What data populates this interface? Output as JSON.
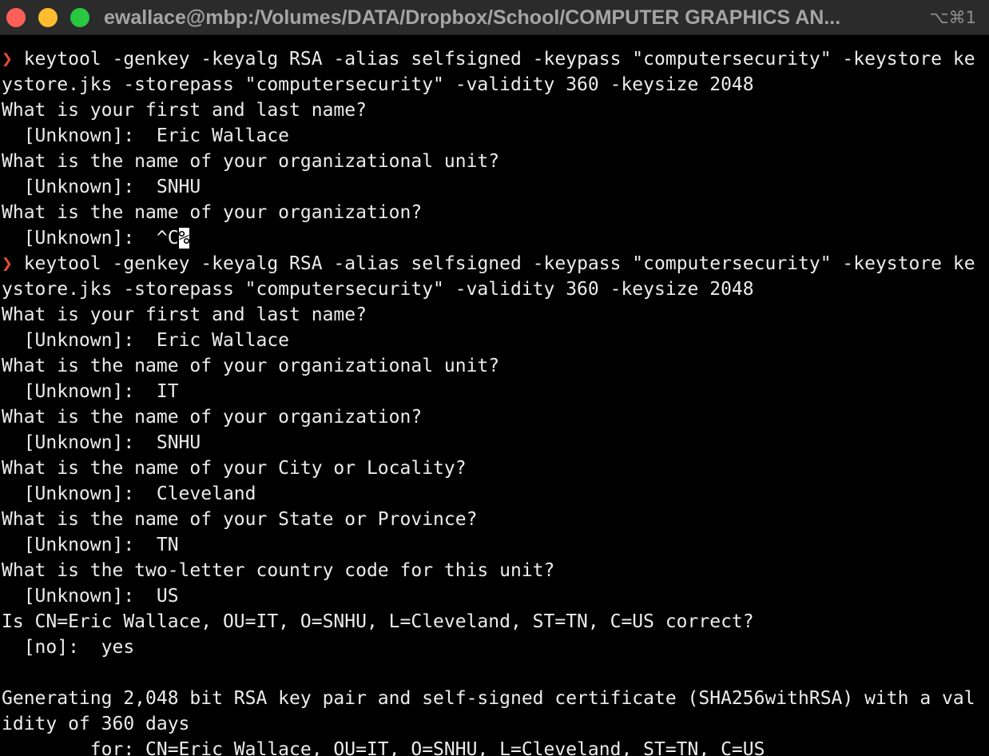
{
  "window": {
    "title": "ewallace@mbp:/Volumes/DATA/Dropbox/School/COMPUTER GRAPHICS AN...",
    "shortcut": "⌥⌘1"
  },
  "terminal": {
    "prompt_symbol": "❯",
    "cursor_char": "%",
    "lines": [
      {
        "type": "prompt",
        "text": " keytool -genkey -keyalg RSA -alias selfsigned -keypass \"computersecurity\" -keystore ke"
      },
      {
        "type": "output",
        "text": "ystore.jks -storepass \"computersecurity\" -validity 360 -keysize 2048"
      },
      {
        "type": "output",
        "text": "What is your first and last name?"
      },
      {
        "type": "output",
        "text": "  [Unknown]:  Eric Wallace"
      },
      {
        "type": "output",
        "text": "What is the name of your organizational unit?"
      },
      {
        "type": "output",
        "text": "  [Unknown]:  SNHU"
      },
      {
        "type": "output",
        "text": "What is the name of your organization?"
      },
      {
        "type": "cursor",
        "text": "  [Unknown]:  ^C"
      },
      {
        "type": "prompt",
        "text": " keytool -genkey -keyalg RSA -alias selfsigned -keypass \"computersecurity\" -keystore ke"
      },
      {
        "type": "output",
        "text": "ystore.jks -storepass \"computersecurity\" -validity 360 -keysize 2048"
      },
      {
        "type": "output",
        "text": "What is your first and last name?"
      },
      {
        "type": "output",
        "text": "  [Unknown]:  Eric Wallace"
      },
      {
        "type": "output",
        "text": "What is the name of your organizational unit?"
      },
      {
        "type": "output",
        "text": "  [Unknown]:  IT"
      },
      {
        "type": "output",
        "text": "What is the name of your organization?"
      },
      {
        "type": "output",
        "text": "  [Unknown]:  SNHU"
      },
      {
        "type": "output",
        "text": "What is the name of your City or Locality?"
      },
      {
        "type": "output",
        "text": "  [Unknown]:  Cleveland"
      },
      {
        "type": "output",
        "text": "What is the name of your State or Province?"
      },
      {
        "type": "output",
        "text": "  [Unknown]:  TN"
      },
      {
        "type": "output",
        "text": "What is the two-letter country code for this unit?"
      },
      {
        "type": "output",
        "text": "  [Unknown]:  US"
      },
      {
        "type": "output",
        "text": "Is CN=Eric Wallace, OU=IT, O=SNHU, L=Cleveland, ST=TN, C=US correct?"
      },
      {
        "type": "output",
        "text": "  [no]:  yes"
      },
      {
        "type": "output",
        "text": ""
      },
      {
        "type": "output",
        "text": "Generating 2,048 bit RSA key pair and self-signed certificate (SHA256withRSA) with a val"
      },
      {
        "type": "output",
        "text": "idity of 360 days"
      },
      {
        "type": "output",
        "text": "        for: CN=Eric Wallace, OU=IT, O=SNHU, L=Cleveland, ST=TN, C=US"
      }
    ]
  }
}
